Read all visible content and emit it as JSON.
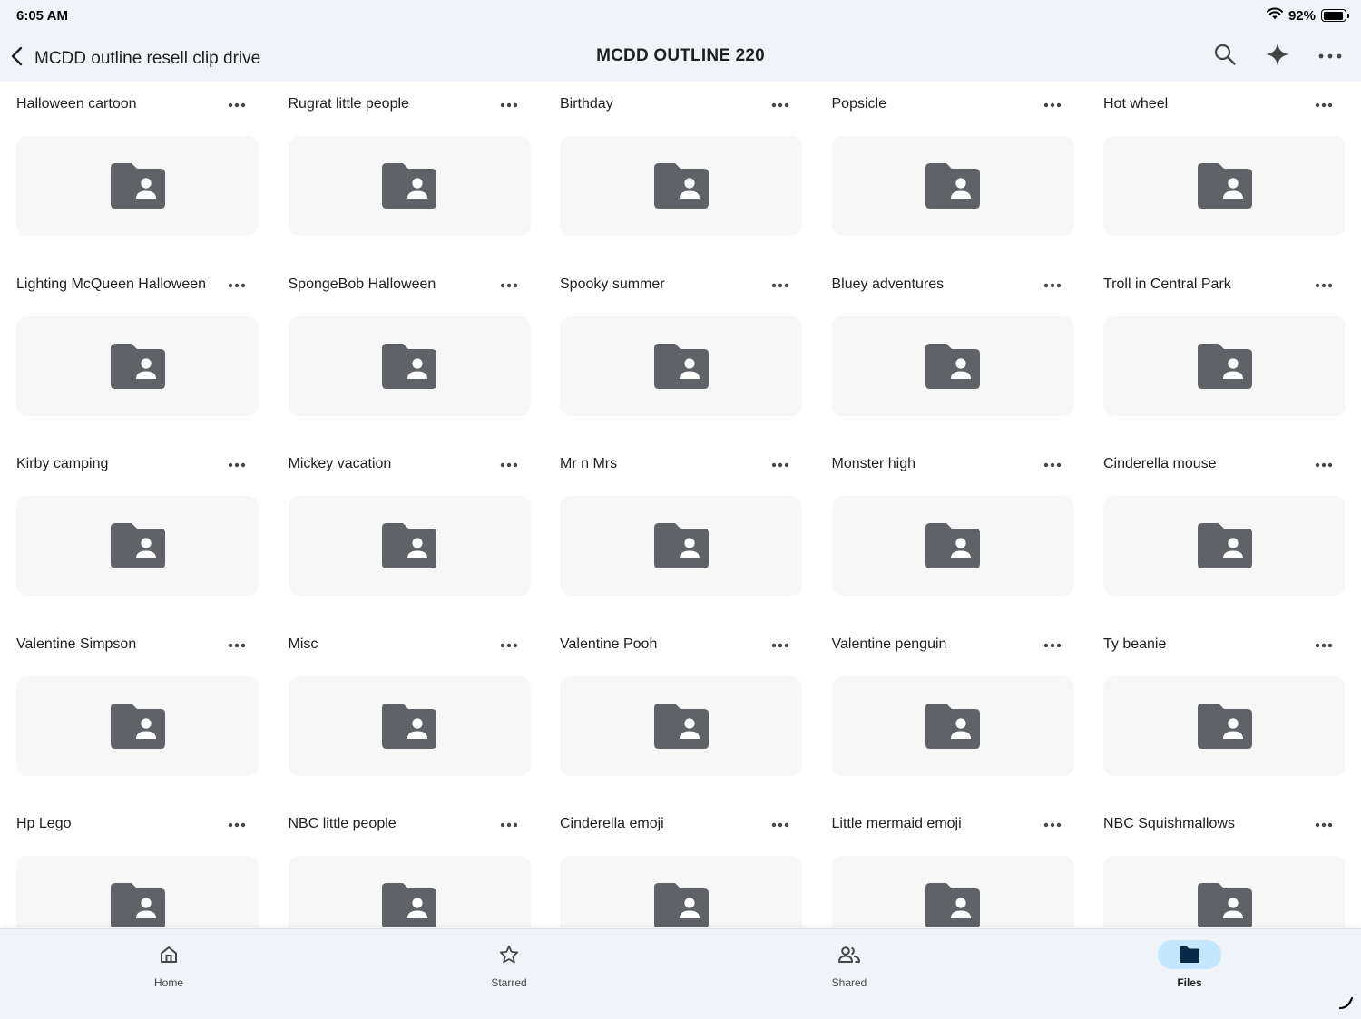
{
  "status_bar": {
    "time": "6:05 AM",
    "battery_percent": "92%",
    "battery_level": 0.92,
    "wifi_icon": "wifi-icon",
    "battery_icon": "battery-icon"
  },
  "header": {
    "back_icon": "chevron-left-icon",
    "back_label": "MCDD outline resell clip drive",
    "title": "MCDD OUTLINE 220",
    "actions": [
      {
        "name": "search-button",
        "icon": "search-icon"
      },
      {
        "name": "gemini-button",
        "icon": "sparkle-icon"
      },
      {
        "name": "overflow-menu-button",
        "icon": "more-horizontal-icon"
      }
    ]
  },
  "folder_icon": "shared-folder-icon",
  "more_icon": "more-horizontal-icon",
  "folders": [
    {
      "name": "Halloween cartoon"
    },
    {
      "name": "Rugrat little people"
    },
    {
      "name": "Birthday"
    },
    {
      "name": "Popsicle"
    },
    {
      "name": "Hot wheel"
    },
    {
      "name": "Lighting McQueen Halloween"
    },
    {
      "name": "SpongeBob Halloween"
    },
    {
      "name": "Spooky summer"
    },
    {
      "name": "Bluey adventures"
    },
    {
      "name": "Troll in Central Park"
    },
    {
      "name": "Kirby camping"
    },
    {
      "name": "Mickey vacation"
    },
    {
      "name": "Mr n Mrs"
    },
    {
      "name": "Monster high"
    },
    {
      "name": "Cinderella mouse"
    },
    {
      "name": "Valentine Simpson"
    },
    {
      "name": "Misc"
    },
    {
      "name": "Valentine Pooh"
    },
    {
      "name": "Valentine penguin"
    },
    {
      "name": "Ty beanie"
    },
    {
      "name": "Hp Lego"
    },
    {
      "name": "NBC little people"
    },
    {
      "name": "Cinderella emoji"
    },
    {
      "name": "Little mermaid emoji"
    },
    {
      "name": "NBC Squishmallows"
    }
  ],
  "bottom_nav": {
    "items": [
      {
        "label": "Home",
        "icon": "home-icon",
        "active": false
      },
      {
        "label": "Starred",
        "icon": "star-icon",
        "active": false
      },
      {
        "label": "Shared",
        "icon": "people-icon",
        "active": false
      },
      {
        "label": "Files",
        "icon": "folder-icon",
        "active": true
      }
    ]
  },
  "colors": {
    "header_bg": "#f0f4f9",
    "folder_icon": "#5f6368",
    "thumb_bg": "#f7f7f7",
    "active_nav_pill": "#c2e7ff",
    "active_nav_icon": "#0b2a4a"
  }
}
